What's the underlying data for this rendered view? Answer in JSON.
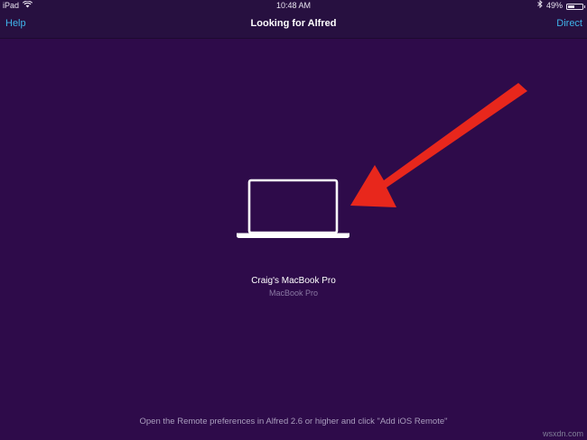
{
  "status_bar": {
    "device": "iPad",
    "time": "10:48 AM",
    "battery_text": "49%",
    "battery_level": 0.49
  },
  "nav": {
    "left_label": "Help",
    "title": "Looking for Alfred",
    "right_label": "Direct"
  },
  "device": {
    "name": "Craig's MacBook Pro",
    "model": "MacBook Pro"
  },
  "footer": {
    "instructions": "Open the Remote preferences in Alfred 2.6 or higher and click \"Add iOS Remote\""
  },
  "watermark": "wsxdn.com",
  "colors": {
    "background": "#2e0b4a",
    "bar": "#271040",
    "accent": "#3fb4ea",
    "arrow": "#e8271c"
  }
}
